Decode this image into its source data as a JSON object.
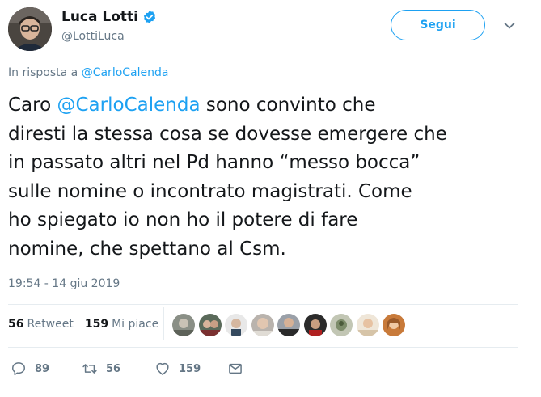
{
  "author": {
    "name": "Luca Lotti",
    "handle": "@LottiLuca"
  },
  "follow_label": "Segui",
  "reply_prefix": "In risposta a",
  "reply_to": "@CarloCalenda",
  "tweet": {
    "line1_pre": "Caro ",
    "line1_mention": "@CarloCalenda",
    "line1_post": " sono convinto che",
    "line2": "diresti la stessa cosa se dovesse emergere che",
    "line3": "in passato altri nel Pd hanno “messo bocca”",
    "line4": "sulle nomine o incontrato magistrati. Come",
    "line5": "ho spiegato io non ho il potere di fare",
    "line6": "nomine, che spettano al Csm."
  },
  "timestamp": "19:54 - 14 giu 2019",
  "stats": {
    "retweets_count": "56",
    "retweets_label": "Retweet",
    "likes_count": "159",
    "likes_label": "Mi piace"
  },
  "actions": {
    "replies": "89",
    "retweets": "56",
    "likes": "159"
  },
  "colors": {
    "accent": "#1da1f2",
    "muted": "#657786",
    "divider": "#e6ecf0"
  },
  "icons": [
    "verified-badge-icon",
    "chevron-down-icon",
    "reply-icon",
    "retweet-icon",
    "like-heart-icon",
    "direct-message-icon"
  ]
}
